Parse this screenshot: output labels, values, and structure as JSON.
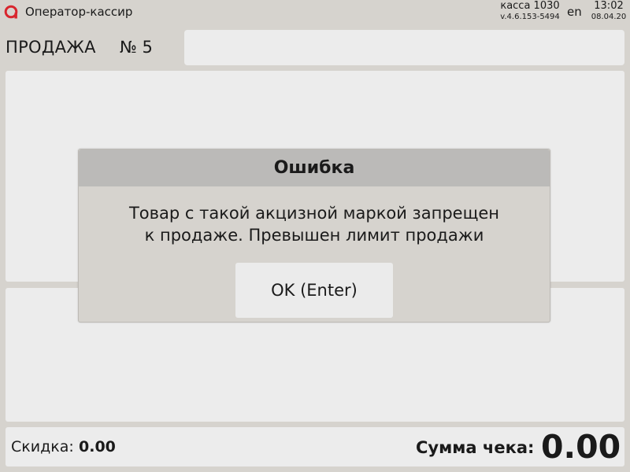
{
  "topbar": {
    "app_title": "Оператор-кассир",
    "register_name": "касса 1030",
    "app_version": "v.4.6.153-5494",
    "language": "en",
    "time": "13:02",
    "date": "08.04.20",
    "logo_icon": "brand-logo-icon",
    "brand_color": "#d8262e"
  },
  "sale": {
    "title": "ПРОДАЖА",
    "number": "№ 5"
  },
  "footer": {
    "discount_label": "Скидка:",
    "discount_value": "0.00",
    "total_label": "Сумма чека:",
    "total_value": "0.00"
  },
  "dialog": {
    "title": "Ошибка",
    "message_line1": "Товар с такой акцизной маркой запрещен",
    "message_line2": "к продаже. Превышен лимит продажи",
    "ok_label": "OK (Enter)"
  }
}
